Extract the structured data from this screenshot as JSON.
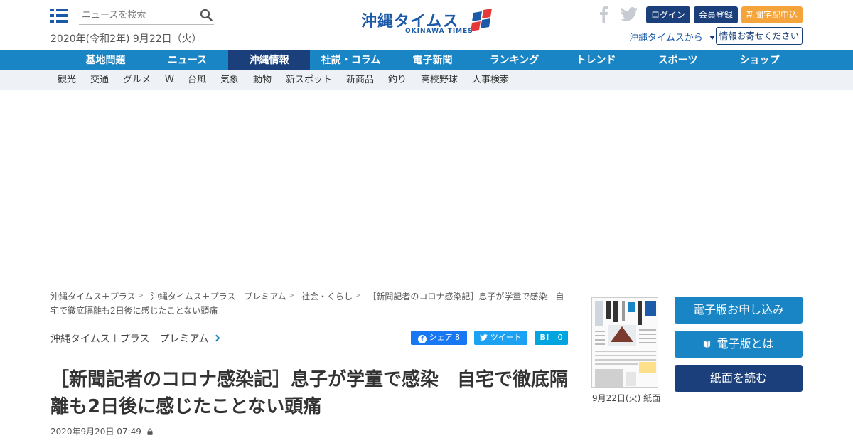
{
  "header": {
    "search_placeholder": "ニュースを検索",
    "date": "2020年(令和2年) 9月22日（火）",
    "logo_main": "沖縄タイムス",
    "logo_plus": "プラス",
    "logo_sub": "OKINAWA TIMES",
    "login": "ログイン",
    "register": "会員登録",
    "delivery": "新聞宅配申込",
    "from_times": "沖縄タイムスから",
    "send_info": "情報お寄せください"
  },
  "nav": {
    "items": [
      "基地問題",
      "ニュース",
      "沖縄情報",
      "社説・コラム",
      "電子新聞",
      "ランキング",
      "トレンド",
      "スポーツ",
      "ショップ"
    ],
    "active": "沖縄情報"
  },
  "subnav": {
    "items": [
      "観光",
      "交通",
      "グルメ",
      "W",
      "台風",
      "気象",
      "動物",
      "新スポット",
      "新商品",
      "釣り",
      "高校野球",
      "人事検索"
    ]
  },
  "breadcrumb": {
    "items": [
      "沖縄タイムス＋プラス",
      "沖縄タイムス＋プラス　プレミアム",
      "社会・くらし",
      "［新聞記者のコロナ感染記］息子が学童で感染　自宅で徹底隔離も2日後に感じたことない頭痛"
    ]
  },
  "article": {
    "category": "沖縄タイムス＋プラス　プレミアム",
    "share_fb_label": "シェア",
    "share_fb_count": "8",
    "tweet_label": "ツイート",
    "hatena_label": "B!",
    "hatena_count": "0",
    "title": "［新聞記者のコロナ感染記］息子が学童で感染　自宅で徹底隔離も2日後に感じたことない頭痛",
    "published": "2020年9月20日 07:49"
  },
  "sidebar": {
    "paper_caption": "9月22日(火) 紙面",
    "apply_digital": "電子版お申し込み",
    "about_digital": "電子版とは",
    "read_paper": "紙面を読む"
  },
  "colors": {
    "brand_blue": "#1b5aa8",
    "nav_blue": "#1a85c4",
    "nav_active": "#1b3f7a",
    "delivery_orange": "#f5a43b",
    "facebook": "#1877f2",
    "twitter": "#1da1f2",
    "hatena": "#00a4de"
  },
  "icons": [
    "menu-icon",
    "search-icon",
    "facebook-icon",
    "twitter-icon",
    "lock-icon",
    "chevron-right-icon",
    "book-icon"
  ]
}
